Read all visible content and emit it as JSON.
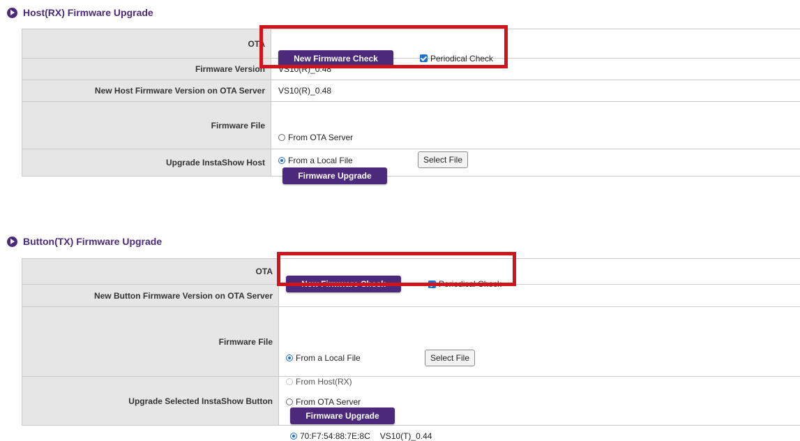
{
  "host": {
    "title": "Host(RX) Firmware Upgrade",
    "ota_label": "OTA",
    "ota_button": "New Firmware Check",
    "periodical_check": "Periodical Check",
    "fw_version_label": "Firmware Version",
    "fw_version_value": "VS10(R)_0.48",
    "new_version_label": "New Host Firmware Version on OTA Server",
    "new_version_value": "VS10(R)_0.48",
    "fw_file_label": "Firmware File",
    "opt_ota": "From OTA Server",
    "opt_local": "From a Local File",
    "select_file": "Select File",
    "upgrade_label": "Upgrade InstaShow Host",
    "upgrade_button": "Firmware Upgrade"
  },
  "button": {
    "title": "Button(TX) Firmware Upgrade",
    "ota_label": "OTA",
    "ota_button": "New Firmware Check",
    "periodical_check": "Periodical Check",
    "new_version_label": "New Button Firmware Version on OTA Server",
    "fw_file_label": "Firmware File",
    "opt_local": "From a Local File",
    "select_file": "Select File",
    "opt_host": "From Host(RX)",
    "opt_ota": "From OTA Server",
    "upgrade_label": "Upgrade Selected InstaShow Button",
    "upgrade_button": "Firmware Upgrade",
    "device_mac": "70:F7:54:88:7E:8C",
    "device_version": "VS10(T)_0.44"
  },
  "colors": {
    "accent": "#4b2a7b",
    "highlight": "#d0141c",
    "check": "#1a6fd1"
  }
}
